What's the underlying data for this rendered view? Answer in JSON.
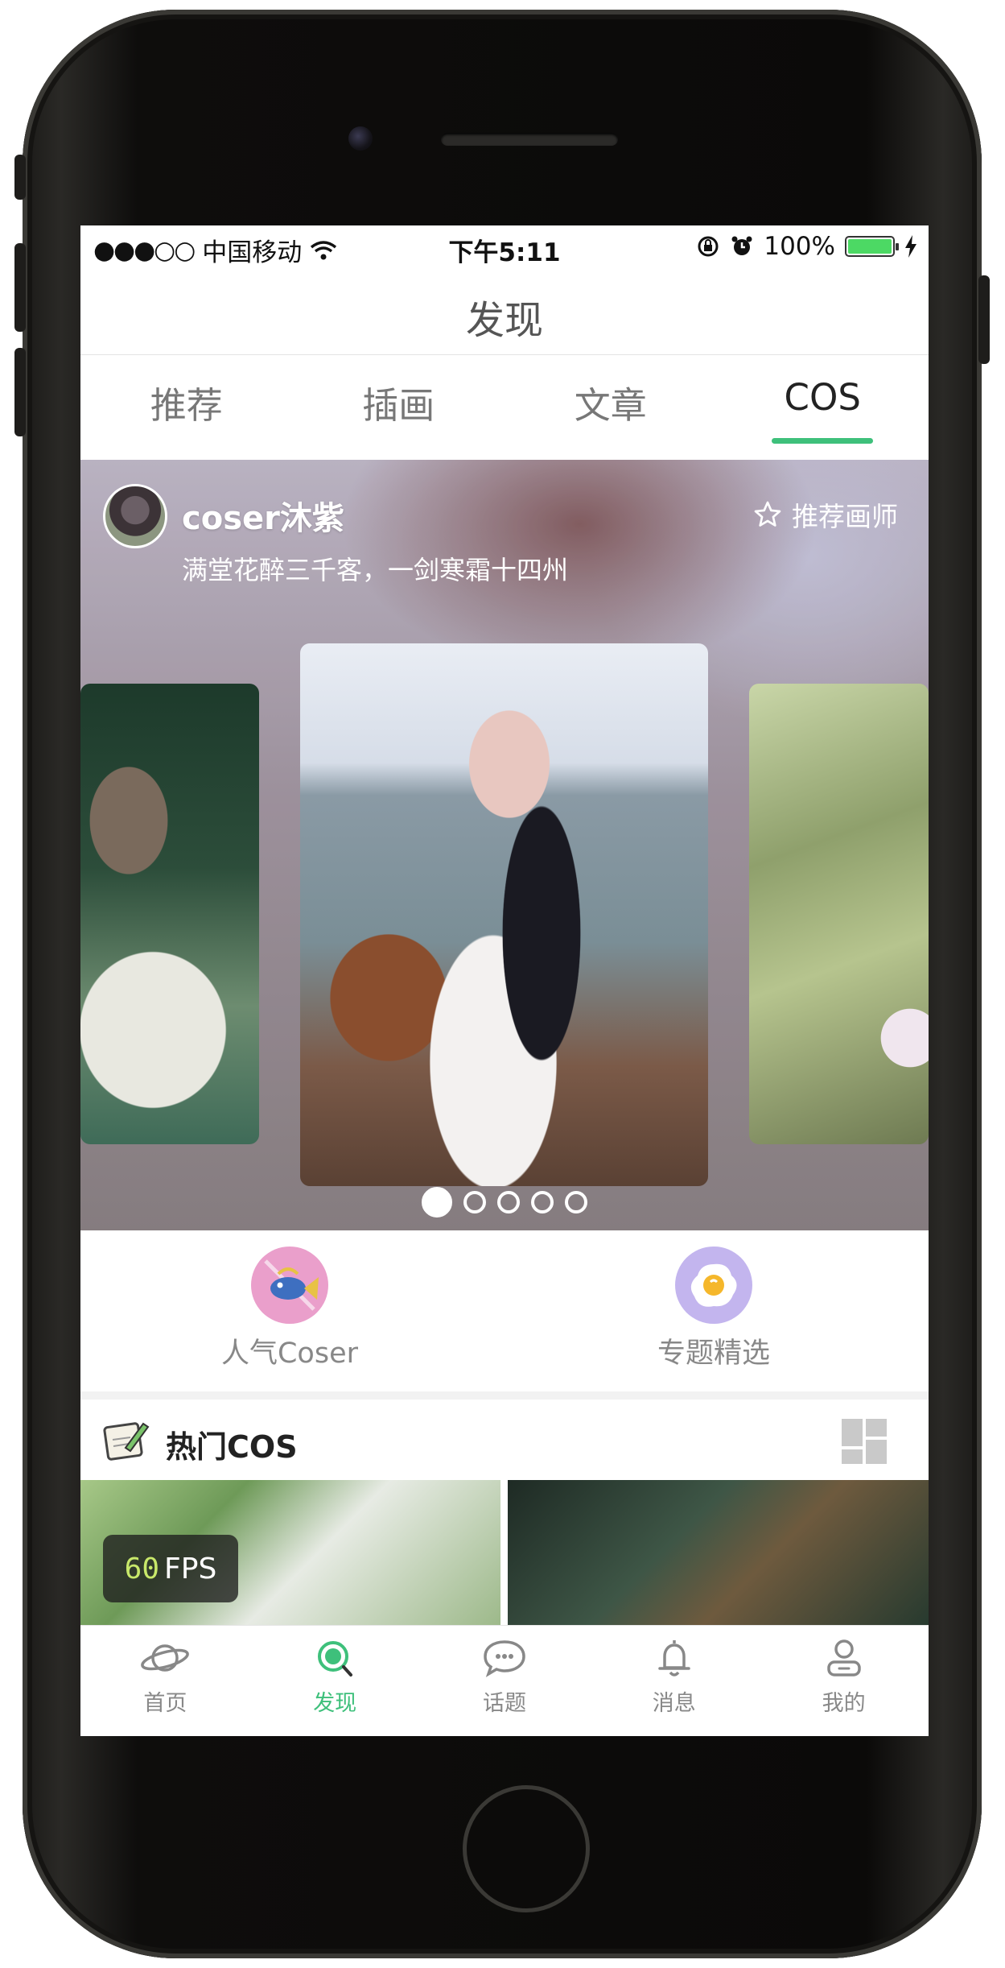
{
  "status_bar": {
    "signal": "●●●○○",
    "carrier": "中国移动",
    "time": "下午5:11",
    "battery_percent": "100%",
    "battery_level": 1.0
  },
  "nav": {
    "title": "发现"
  },
  "tabs": [
    {
      "label": "推荐",
      "active": false
    },
    {
      "label": "插画",
      "active": false
    },
    {
      "label": "文章",
      "active": false
    },
    {
      "label": "COS",
      "active": true
    }
  ],
  "hero": {
    "coser_name": "coser沐紫",
    "quote": "满堂花醉三千客，一剑寒霜十四州",
    "recommend_label": "推荐画师",
    "carousel_pages": 5,
    "carousel_active_index": 0
  },
  "entries": [
    {
      "label": "人气Coser",
      "icon": "fish-icon"
    },
    {
      "label": "专题精选",
      "icon": "egg-icon"
    }
  ],
  "hot_section": {
    "title": "热门COS",
    "layout_icon": "grid-layout-icon"
  },
  "fps_overlay": {
    "value": "60",
    "unit": "FPS"
  },
  "tab_bar": [
    {
      "label": "首页",
      "icon": "planet-icon",
      "active": false
    },
    {
      "label": "发现",
      "icon": "discover-icon",
      "active": true
    },
    {
      "label": "话题",
      "icon": "chat-bubble-icon",
      "active": false
    },
    {
      "label": "消息",
      "icon": "bell-icon",
      "active": false
    },
    {
      "label": "我的",
      "icon": "profile-icon",
      "active": false
    }
  ],
  "colors": {
    "accent": "#3ec07b",
    "fish_icon_bg": "#ea9fcb",
    "egg_icon_bg": "#c3b5ee",
    "battery": "#4cd964"
  }
}
